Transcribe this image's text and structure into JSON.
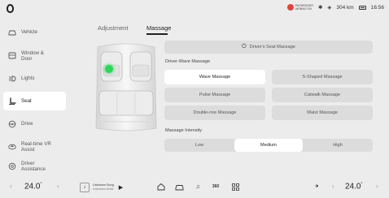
{
  "status": {
    "airbag_line1": "PASSENGER",
    "airbag_line2": "AIRBAG ON",
    "bluetooth": "✱",
    "wifi": "◈",
    "range": "304 km",
    "time": "16:56"
  },
  "sidebar": {
    "items": [
      {
        "label": "Vehicle"
      },
      {
        "label": "Window &\nDoor"
      },
      {
        "label": "Lights"
      },
      {
        "label": "Seat"
      },
      {
        "label": "Drive"
      },
      {
        "label": "Real-time VR\nAssist"
      },
      {
        "label": "Driver\nAssistance"
      }
    ]
  },
  "tabs": [
    {
      "label": "Adjustment"
    },
    {
      "label": "Massage"
    }
  ],
  "massage": {
    "drivers_seat_button": "Driver's Seat Massage",
    "wave_section": "Driver-Wave Massage",
    "modes": [
      {
        "label": "Wave Massage"
      },
      {
        "label": "S-Shaped Massage"
      },
      {
        "label": "Pulse Massage"
      },
      {
        "label": "Catwalk Massage"
      },
      {
        "label": "Double-row Massage"
      },
      {
        "label": "Waist Massage"
      }
    ],
    "selected_mode": "Wave Massage",
    "intensity_section": "Massage Intensity",
    "intensity_options": [
      {
        "label": "Low"
      },
      {
        "label": "Medium"
      },
      {
        "label": "High"
      }
    ],
    "selected_intensity": "Medium"
  },
  "dock": {
    "temp_left": "24.0",
    "temp_right": "24.0",
    "degree": "°",
    "song_title": "Unknown Song",
    "song_artist": "Unknown Artist",
    "fan_label": "360"
  }
}
